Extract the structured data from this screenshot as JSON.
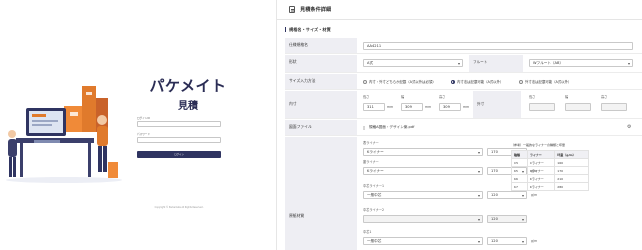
{
  "login": {
    "brand": "パケメイト",
    "sub": "見積",
    "field1_label": "ログインID",
    "field2_label": "パスワード",
    "button_label": "ログイン",
    "copyright": "Copyright © Packemate All Rights Reserved."
  },
  "header": {
    "title": "見積条件詳細"
  },
  "section": {
    "title": "規格名・サイズ・材質"
  },
  "spec_name": {
    "label": "仕様規格名",
    "value": "AA4211"
  },
  "shape": {
    "label": "形状",
    "value": "A式",
    "flute_label": "フルート",
    "flute_value": "Wフルート（AB）"
  },
  "size_method": {
    "label": "サイズ入力方法",
    "options": [
      "内寸・外寸どちらか記載（A式以外は必須）",
      "内寸法は記載可能（A式以外）",
      "外寸法は記載可能（A式以外）"
    ]
  },
  "inner": {
    "label": "内寸",
    "length_label": "長さ",
    "width_label": "幅",
    "height_label": "高さ",
    "length": "311",
    "width": "309",
    "height": "309",
    "unit": "mm",
    "outer_label": "外寸",
    "o_length_label": "長さ",
    "o_width_label": "幅",
    "o_height_label": "高さ"
  },
  "drawing": {
    "label": "図面ファイル",
    "file": "規格A図面・デザイン案.pdf"
  },
  "material": {
    "label": "原紙材質",
    "front_label": "表ライナー",
    "front_value": "Kライナー",
    "front_weight": "170",
    "back_label": "裏ライナー",
    "back_value": "Kライナー",
    "back_weight": "170",
    "mid1_label": "中芯ライナー1",
    "mid1_value": "一般中芯",
    "mid1_weight": "120",
    "mid2_label": "中芯ライナー2",
    "mid2_weight": "120",
    "mid3_label": "中芯1",
    "mid3_value": "一般中芯",
    "mid3_weight": "120",
    "unit": "g/m"
  },
  "ref_table": {
    "title": "（参考）一般的なライナーの種類と坪量",
    "headers": [
      "種類",
      "ライナー",
      "坪量（g/m）"
    ],
    "rows": [
      [
        "C5",
        "Cライナー",
        "160"
      ],
      [
        "K5",
        "Kライナー",
        "170"
      ],
      [
        "K6",
        "Kライナー",
        "210"
      ],
      [
        "K7",
        "Kライナー",
        "280"
      ]
    ]
  }
}
